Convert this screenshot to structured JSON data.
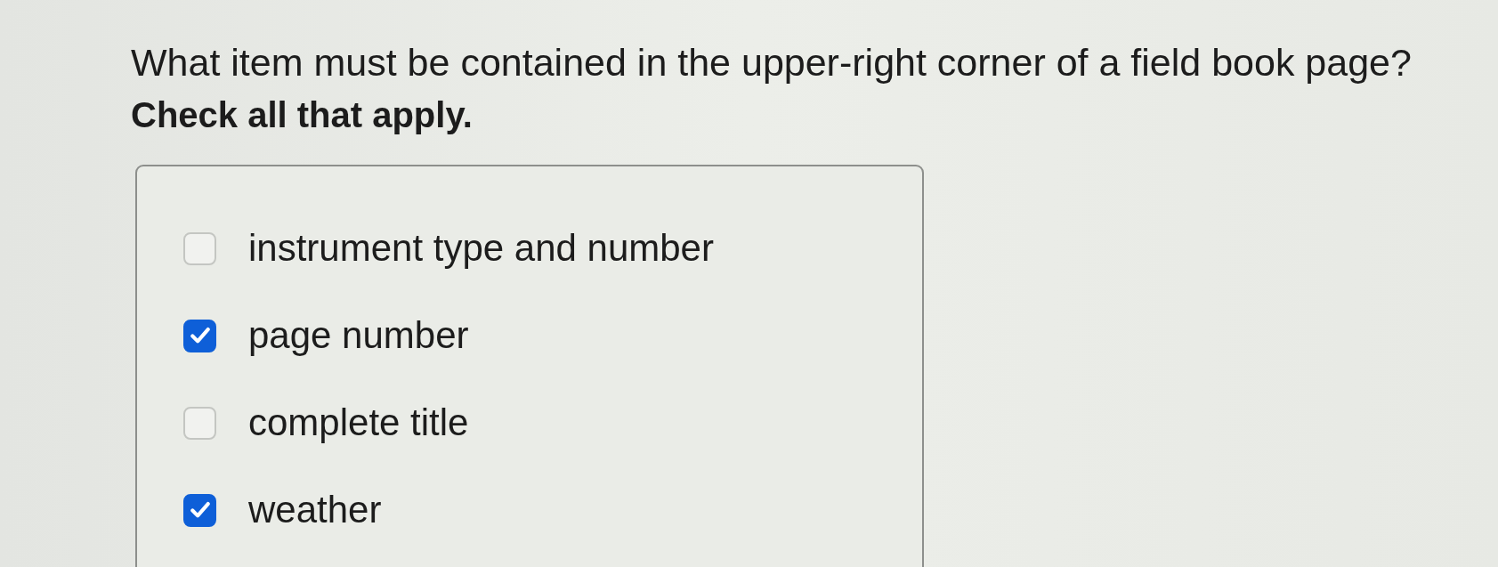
{
  "question": "What item must be contained in the upper-right corner of a field book page?",
  "instruction": "Check all that apply.",
  "options": [
    {
      "label": "instrument type and number",
      "checked": false
    },
    {
      "label": "page number",
      "checked": true
    },
    {
      "label": "complete title",
      "checked": false
    },
    {
      "label": "weather",
      "checked": true
    }
  ]
}
